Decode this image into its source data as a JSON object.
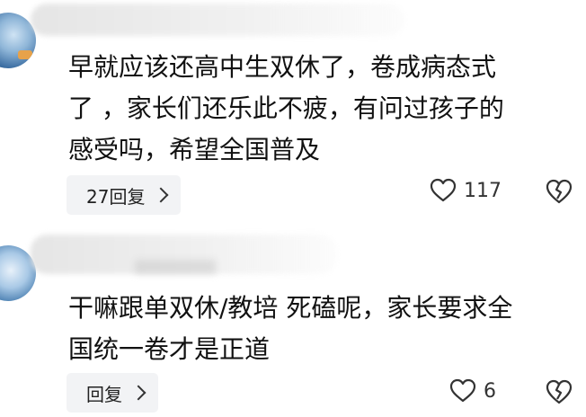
{
  "comments": [
    {
      "text": "早就应该还高中生双休了，卷成病态式\n了 ，家长们还乐此不疲，有问过孩子的\n感受吗，希望全国普及",
      "reply_label": "27回复",
      "like_count": "117"
    },
    {
      "text": "干嘛跟单双休/教培 死磕呢，家长要求全\n国统一卷才是正道",
      "reply_label": "回复",
      "like_count": "6"
    }
  ],
  "icons": {
    "like": "heart-icon",
    "dislike": "broken-heart-icon",
    "reply_arrow": "chevron-right-icon"
  },
  "colors": {
    "text": "#111111",
    "reply_bg": "#f2f3f5",
    "icon": "#333333"
  }
}
